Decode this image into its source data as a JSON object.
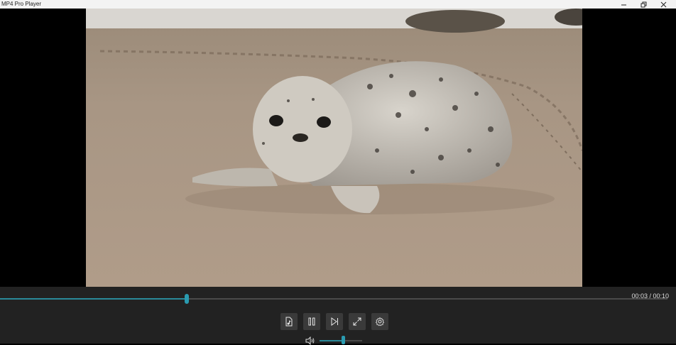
{
  "window": {
    "title": "MP4 Pro Player"
  },
  "playback": {
    "current_time": "00:03",
    "total_time": "00:10",
    "time_display": "00:03 / 00:10",
    "progress": 0.28
  },
  "volume": {
    "level": 0.55
  },
  "controls": [
    {
      "name": "open-file-button",
      "icon": "file-audio-icon"
    },
    {
      "name": "pause-button",
      "icon": "pause-icon"
    },
    {
      "name": "next-button",
      "icon": "skip-next-icon"
    },
    {
      "name": "fullscreen-button",
      "icon": "expand-icon"
    },
    {
      "name": "settings-button",
      "icon": "gear-icon"
    }
  ],
  "colors": {
    "accent": "#2a9bb0",
    "control_bg": "#222222",
    "titlebar_bg": "#f3f3f3"
  }
}
